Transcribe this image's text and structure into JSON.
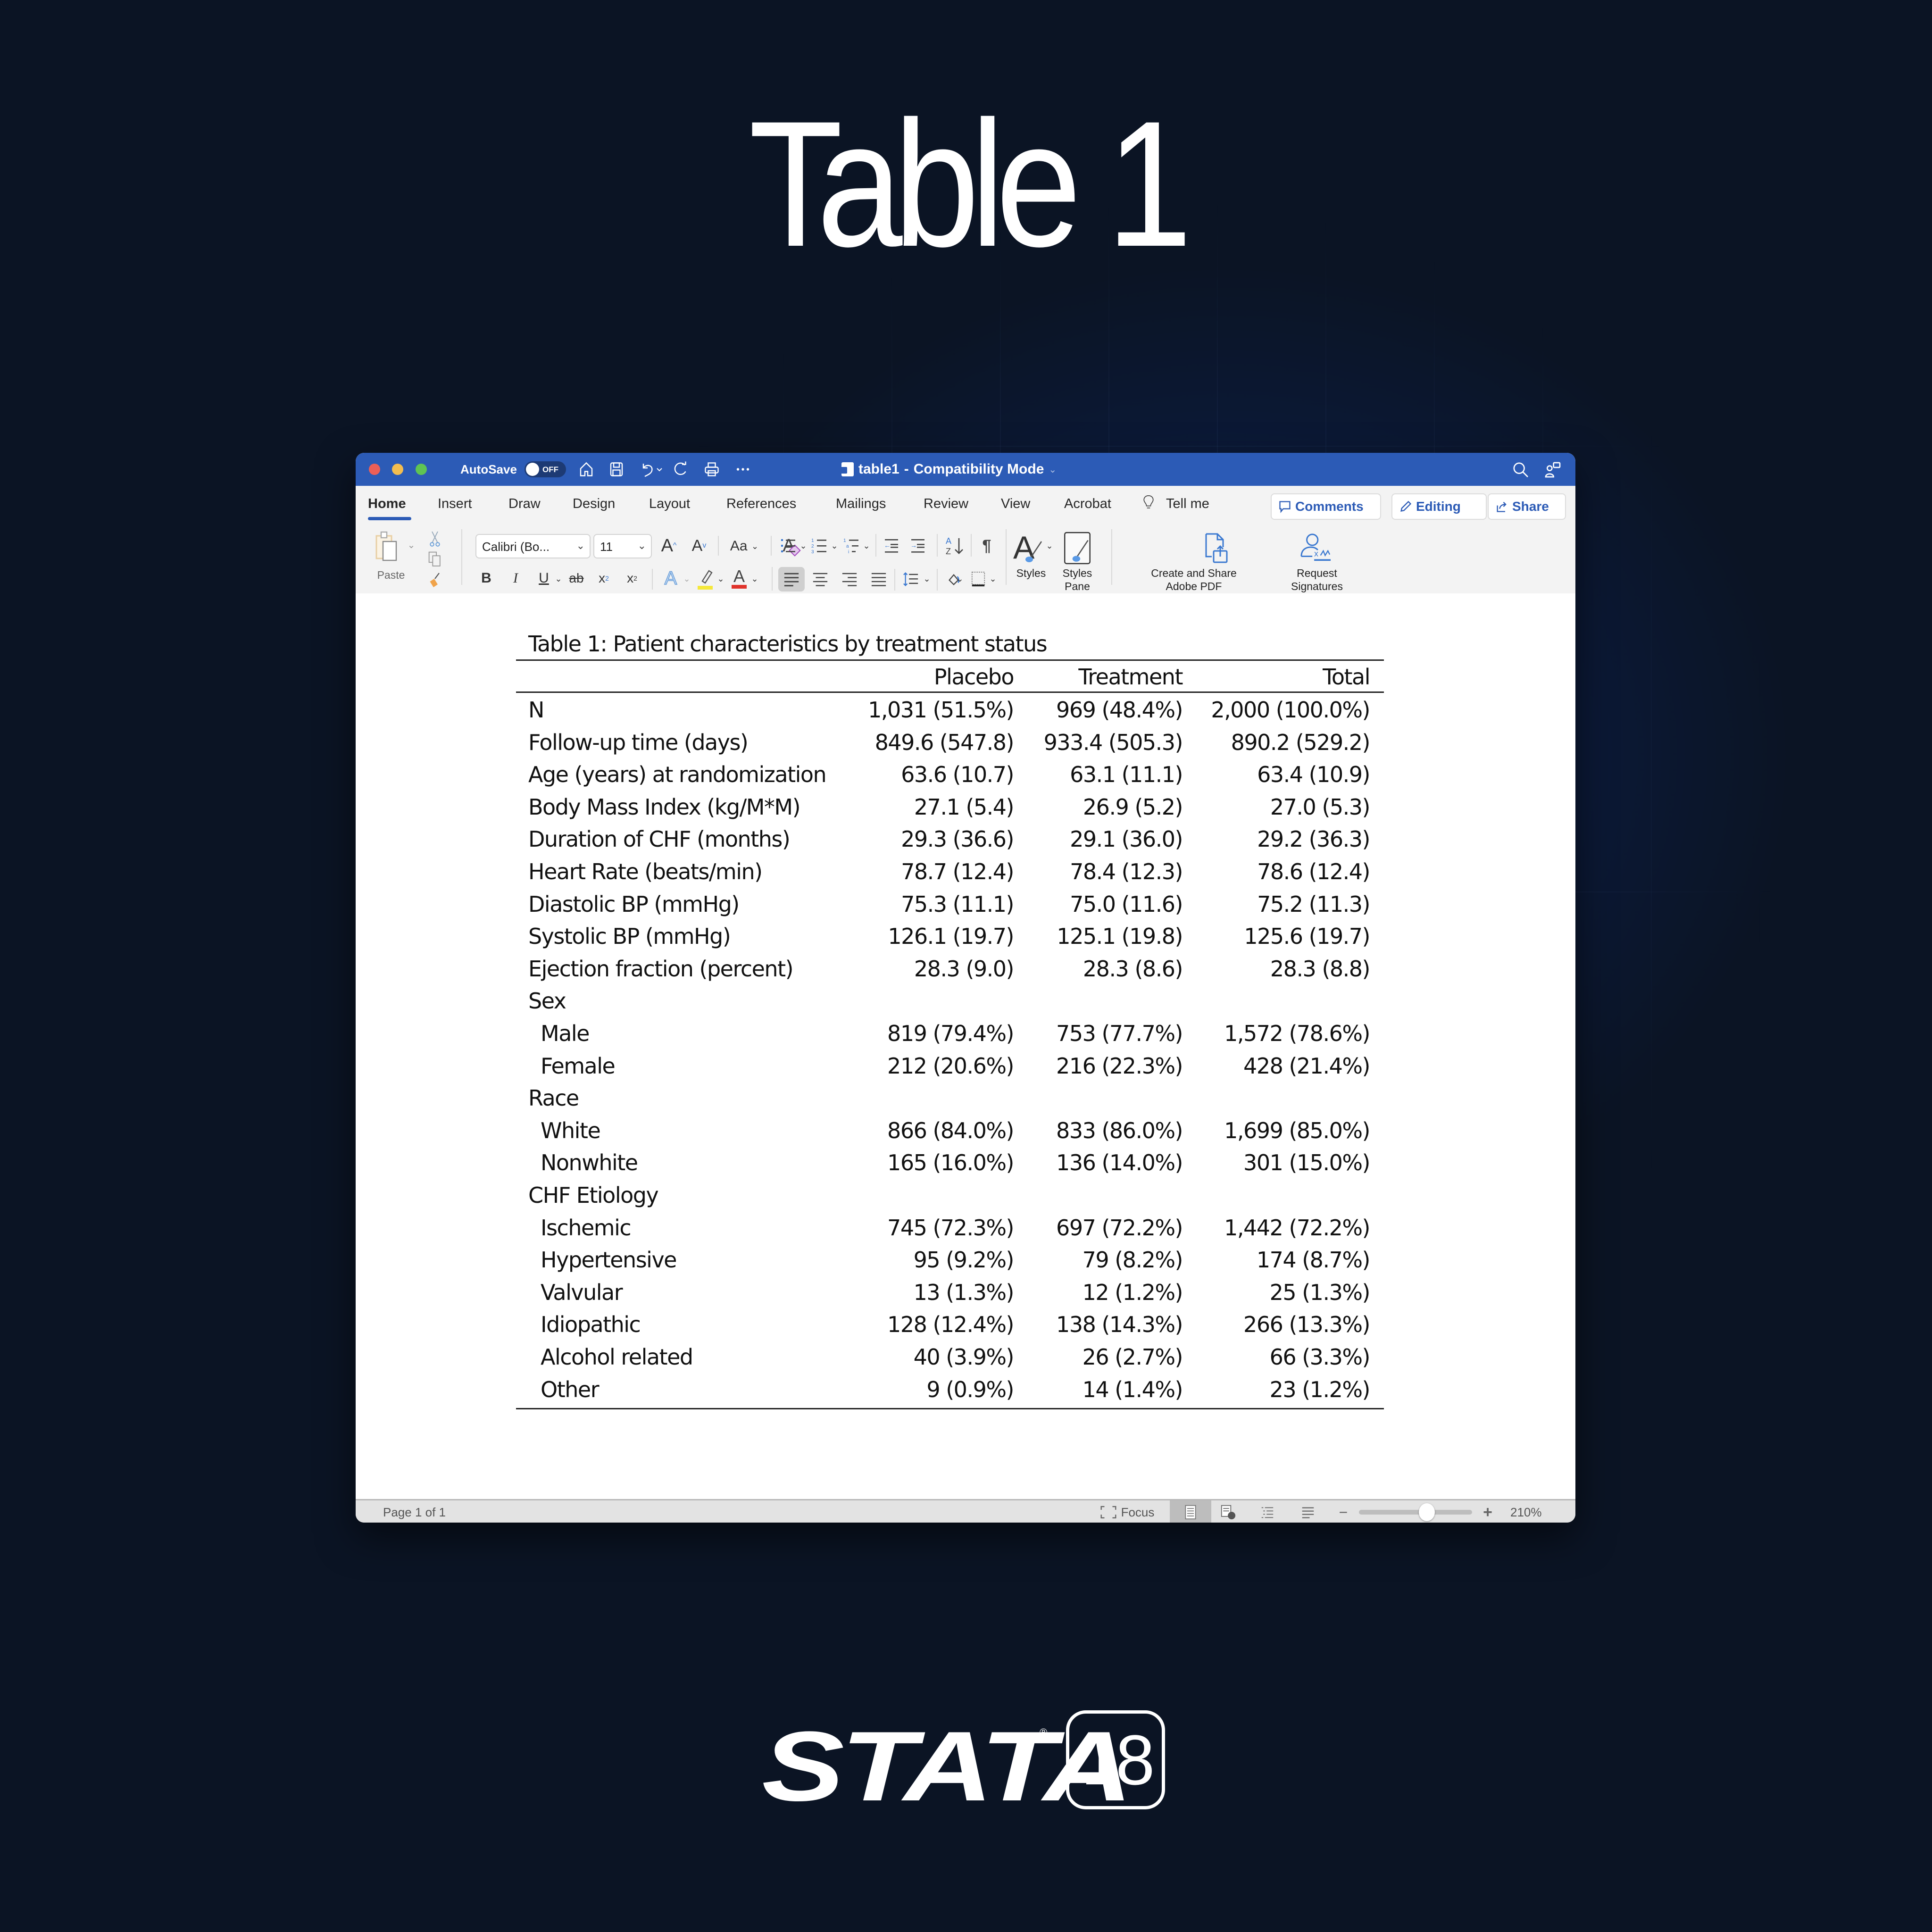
{
  "hero": {
    "title": "Table 1"
  },
  "window": {
    "autosave_label": "AutoSave",
    "autosave_state": "OFF",
    "doc_name": "table1",
    "doc_separator": "-",
    "doc_mode": "Compatibility Mode",
    "titlebar_icons": [
      "home-icon",
      "save-icon",
      "undo-icon",
      "redo-icon",
      "print-icon",
      "more-icon"
    ],
    "right_icons": [
      "search-icon",
      "share-people-icon"
    ]
  },
  "ribbon_tabs": [
    {
      "label": "Home",
      "active": true
    },
    {
      "label": "Insert"
    },
    {
      "label": "Draw"
    },
    {
      "label": "Design"
    },
    {
      "label": "Layout"
    },
    {
      "label": "References"
    },
    {
      "label": "Mailings"
    },
    {
      "label": "Review"
    },
    {
      "label": "View"
    },
    {
      "label": "Acrobat"
    },
    {
      "label": "Tell me"
    }
  ],
  "ribbon_buttons": {
    "comments": "Comments",
    "editing": "Editing",
    "share": "Share"
  },
  "toolbar": {
    "paste_label": "Paste",
    "font_name": "Calibri (Bo...",
    "font_size": "11",
    "change_case": "Aa",
    "styles_label": "Styles",
    "styles_pane_label": "Styles Pane",
    "create_pdf_label": "Create and Share Adobe PDF",
    "request_sig_label": "Request Signatures",
    "highlight_color": "#f5e83a",
    "font_color": "#e0332b"
  },
  "document": {
    "caption": "Table 1: Patient characteristics by treatment status",
    "columns": [
      "",
      "Placebo",
      "Treatment",
      "Total"
    ],
    "rows": [
      {
        "label": "N",
        "indent": false,
        "values": [
          "1,031 (51.5%)",
          "969 (48.4%)",
          "2,000 (100.0%)"
        ]
      },
      {
        "label": "Follow-up time (days)",
        "indent": false,
        "values": [
          "849.6 (547.8)",
          "933.4 (505.3)",
          "890.2 (529.2)"
        ]
      },
      {
        "label": "Age (years) at randomization",
        "indent": false,
        "values": [
          "63.6 (10.7)",
          "63.1 (11.1)",
          "63.4 (10.9)"
        ]
      },
      {
        "label": "Body Mass Index (kg/M*M)",
        "indent": false,
        "values": [
          "27.1 (5.4)",
          "26.9 (5.2)",
          "27.0 (5.3)"
        ]
      },
      {
        "label": "Duration of CHF (months)",
        "indent": false,
        "values": [
          "29.3 (36.6)",
          "29.1 (36.0)",
          "29.2 (36.3)"
        ]
      },
      {
        "label": "Heart Rate (beats/min)",
        "indent": false,
        "values": [
          "78.7 (12.4)",
          "78.4 (12.3)",
          "78.6 (12.4)"
        ]
      },
      {
        "label": "Diastolic BP (mmHg)",
        "indent": false,
        "values": [
          "75.3 (11.1)",
          "75.0 (11.6)",
          "75.2 (11.3)"
        ]
      },
      {
        "label": "Systolic BP (mmHg)",
        "indent": false,
        "values": [
          "126.1 (19.7)",
          "125.1 (19.8)",
          "125.6 (19.7)"
        ]
      },
      {
        "label": "Ejection fraction (percent)",
        "indent": false,
        "values": [
          "28.3 (9.0)",
          "28.3 (8.6)",
          "28.3 (8.8)"
        ]
      },
      {
        "label": "Sex",
        "indent": false,
        "values": [
          "",
          "",
          ""
        ]
      },
      {
        "label": "Male",
        "indent": true,
        "values": [
          "819 (79.4%)",
          "753 (77.7%)",
          "1,572 (78.6%)"
        ]
      },
      {
        "label": "Female",
        "indent": true,
        "values": [
          "212 (20.6%)",
          "216 (22.3%)",
          "428 (21.4%)"
        ]
      },
      {
        "label": "Race",
        "indent": false,
        "values": [
          "",
          "",
          ""
        ]
      },
      {
        "label": "White",
        "indent": true,
        "values": [
          "866 (84.0%)",
          "833 (86.0%)",
          "1,699 (85.0%)"
        ]
      },
      {
        "label": "Nonwhite",
        "indent": true,
        "values": [
          "165 (16.0%)",
          "136 (14.0%)",
          "301 (15.0%)"
        ]
      },
      {
        "label": "CHF Etiology",
        "indent": false,
        "values": [
          "",
          "",
          ""
        ]
      },
      {
        "label": "Ischemic",
        "indent": true,
        "values": [
          "745 (72.3%)",
          "697 (72.2%)",
          "1,442 (72.2%)"
        ]
      },
      {
        "label": "Hypertensive",
        "indent": true,
        "values": [
          "95 (9.2%)",
          "79 (8.2%)",
          "174 (8.7%)"
        ]
      },
      {
        "label": "Valvular",
        "indent": true,
        "values": [
          "13 (1.3%)",
          "12 (1.2%)",
          "25 (1.3%)"
        ]
      },
      {
        "label": "Idiopathic",
        "indent": true,
        "values": [
          "128 (12.4%)",
          "138 (14.3%)",
          "266 (13.3%)"
        ]
      },
      {
        "label": "Alcohol related",
        "indent": true,
        "values": [
          "40 (3.9%)",
          "26 (2.7%)",
          "66 (3.3%)"
        ]
      },
      {
        "label": "Other",
        "indent": true,
        "values": [
          "9 (0.9%)",
          "14 (1.4%)",
          "23 (1.2%)"
        ]
      }
    ]
  },
  "statusbar": {
    "page_info": "Page 1 of 1",
    "focus_label": "Focus",
    "zoom_level": "210%",
    "zoom_slider_fraction": 0.6
  },
  "brand": {
    "name": "STATA",
    "registered": "®",
    "version": "18"
  },
  "colors": {
    "titlebar": "#2c5bb6",
    "accent": "#2c5bb6",
    "background": "#0b1424"
  }
}
